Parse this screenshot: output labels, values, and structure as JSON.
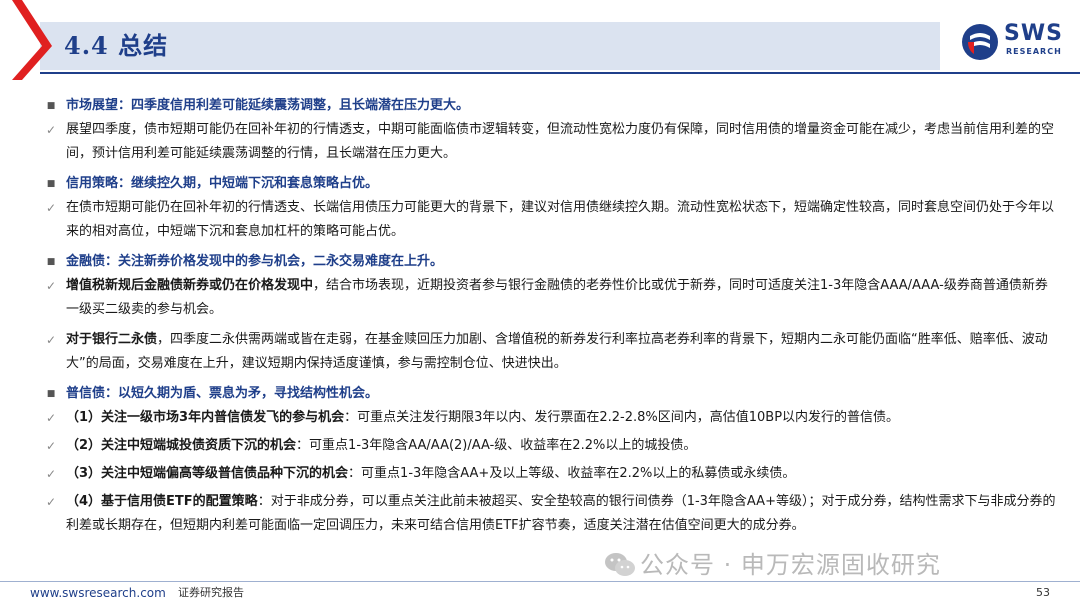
{
  "header": {
    "title": "4.4 总结",
    "logo_text": "SWS",
    "logo_sub": "RESEARCH",
    "accent_color": "#1f3f8a",
    "slant_color": "#e02020"
  },
  "sections": [
    {
      "heading": "市场展望：四季度信用利差可能延续震荡调整，且长端潜在压力更大。",
      "items": [
        {
          "bold": "",
          "text": "展望四季度，债市短期可能仍在回补年初的行情透支，中期可能面临债市逻辑转变，但流动性宽松力度仍有保障，同时信用债的增量资金可能在减少，考虑当前信用利差的空间，预计信用利差可能延续震荡调整的行情，且长端潜在压力更大。"
        }
      ]
    },
    {
      "heading": "信用策略：继续控久期，中短端下沉和套息策略占优。",
      "items": [
        {
          "bold": "",
          "text": "在债市短期可能仍在回补年初的行情透支、长端信用债压力可能更大的背景下，建议对信用债继续控久期。流动性宽松状态下，短端确定性较高，同时套息空间仍处于今年以来的相对高位，中短端下沉和套息加杠杆的策略可能占优。"
        }
      ]
    },
    {
      "heading": "金融债：关注新券价格发现中的参与机会，二永交易难度在上升。",
      "items": [
        {
          "bold": "增值税新规后金融债新券或仍在价格发现中",
          "text": "，结合市场表现，近期投资者参与银行金融债的老券性价比或优于新券，同时可适度关注1-3年隐含AAA/AAA-级券商普通债新券一级买二级卖的参与机会。"
        },
        {
          "bold": "对于银行二永债",
          "text": "，四季度二永供需两端或皆在走弱，在基金赎回压力加剧、含增值税的新券发行利率拉高老券利率的背景下，短期内二永可能仍面临“胜率低、赔率低、波动大”的局面，交易难度在上升，建议短期内保持适度谨慎，参与需控制仓位、快进快出。"
        }
      ]
    },
    {
      "heading": "普信债：以短久期为盾、票息为矛，寻找结构性机会。",
      "items": [
        {
          "bold": "（1）关注一级市场3年内普信债发飞的参与机会",
          "text": "：可重点关注发行期限3年以内、发行票面在2.2-2.8%区间内，高估值10BP以内发行的普信债。"
        },
        {
          "bold": "（2）关注中短端城投债资质下沉的机会",
          "text": "：可重点1-3年隐含AA/AA(2)/AA-级、收益率在2.2%以上的城投债。"
        },
        {
          "bold": "（3）关注中短端偏高等级普信债品种下沉的机会",
          "text": "：可重点1-3年隐含AA+及以上等级、收益率在2.2%以上的私募债或永续债。"
        },
        {
          "bold": "（4）基于信用债ETF的配置策略",
          "text": "：对于非成分券，可以重点关注此前未被超买、安全垫较高的银行间债券（1-3年隐含AA+等级）；对于成分券，结构性需求下与非成分券的利差或长期存在，但短期内利差可能面临一定回调压力，未来可结合信用债ETF扩容节奏，适度关注潜在估值空间更大的成分券。"
        }
      ]
    }
  ],
  "watermark": "公众号 · 申万宏源固收研究",
  "footer": {
    "url": "www.swsresearch.com",
    "label": "证券研究报告",
    "page": "53"
  },
  "icons": {
    "section_bullet": "■",
    "item_bullet": "✓"
  }
}
